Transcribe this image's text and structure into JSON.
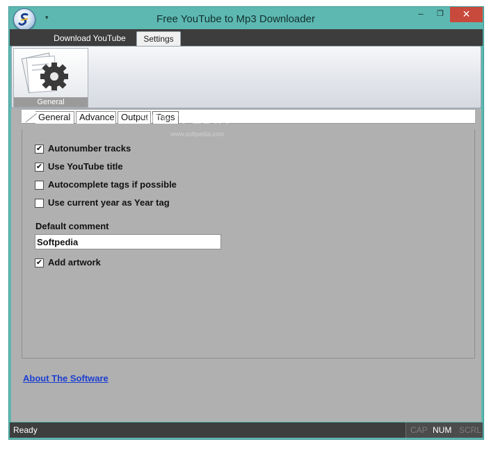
{
  "window": {
    "title": "Free YouTube to Mp3 Downloader",
    "min_label": "–",
    "max_label": "❐",
    "close_label": "✕",
    "qa_arrow": "▾"
  },
  "ribbon_tabs": [
    {
      "label": "Download YouTube",
      "selected": false
    },
    {
      "label": "Settings",
      "selected": true
    }
  ],
  "ribbon": {
    "general_button_label": "General"
  },
  "settings_tabs": [
    {
      "label": "General"
    },
    {
      "label": "Advance"
    },
    {
      "label": "Output"
    },
    {
      "label": "Tags",
      "selected": true
    }
  ],
  "tags_panel": {
    "autonumber": {
      "label": "Autonumber tracks",
      "checked": true,
      "mark": "✔"
    },
    "use_youtube_title": {
      "label": "Use YouTube title",
      "checked": true,
      "mark": "✔"
    },
    "autocomplete_tags": {
      "label": "Autocomplete tags if possible",
      "checked": false,
      "mark": ""
    },
    "use_current_year": {
      "label": "Use current year as Year tag",
      "checked": false,
      "mark": ""
    },
    "default_comment_label": "Default comment",
    "default_comment_value": "Softpedia",
    "add_artwork": {
      "label": "Add artwork",
      "checked": true,
      "mark": "✔"
    }
  },
  "about_link": "About The Software",
  "status": {
    "text": "Ready",
    "cap": "CAP",
    "num": "NUM",
    "scrl": "SCRL"
  },
  "watermark": {
    "text": "SOFTPEDIA",
    "sub": "www.softpedia.com"
  },
  "colors": {
    "frame": "#5db8b2",
    "close": "#c74a3c",
    "link": "#1b3fd1",
    "content": "#b0b0b0"
  }
}
